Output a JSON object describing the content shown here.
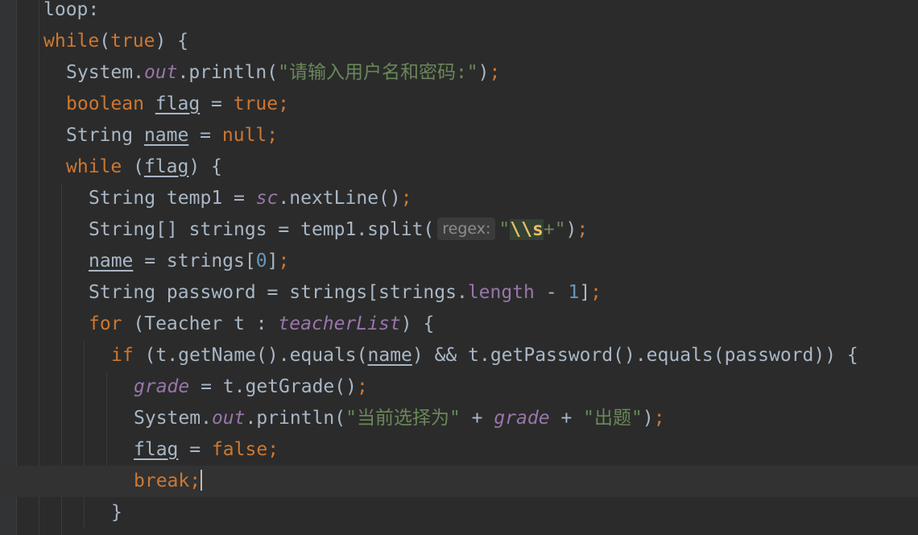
{
  "editor": {
    "theme_colors": {
      "background": "#2b2b2b",
      "keyword": "#cc7832",
      "string": "#6a8759",
      "field": "#9876aa",
      "number": "#6897bb",
      "text": "#a9b7c6"
    },
    "lines": {
      "l1": {
        "label": "loop:"
      },
      "l2": {
        "kw_while": "while",
        "p1": "(",
        "kw_true": "true",
        "p2": ") {"
      },
      "l3": {
        "sys": "System.",
        "out": "out",
        "println": ".println(",
        "str": "\"请输入用户名和密码:\"",
        "close": ")",
        "semi": ";"
      },
      "l4": {
        "kw_boolean": "boolean",
        "sp": " ",
        "flag": "flag",
        "eq": " = ",
        "kw_true": "true",
        "semi": ";"
      },
      "l5": {
        "type": "String ",
        "name": "name",
        "eq": " = ",
        "kw_null": "null",
        "semi": ";"
      },
      "l6": {
        "kw_while": "while",
        "p1": " (",
        "flag": "flag",
        "p2": ") {"
      },
      "l7": {
        "a": "String temp1 = ",
        "sc": "sc",
        "b": ".nextLine()",
        "semi": ";"
      },
      "l8": {
        "a": "String[] strings = temp1.split(",
        "hint": "regex:",
        "q1": "\"",
        "esc": "\\\\s",
        "plus": "+",
        "q2": "\"",
        "close": ")",
        "semi": ";"
      },
      "l9": {
        "name": "name",
        "a": " = strings[",
        "zero": "0",
        "b": "]",
        "semi": ";"
      },
      "l10": {
        "a": "String password = strings[strings.",
        "length": "length",
        "b": " - ",
        "one": "1",
        "c": "]",
        "semi": ";"
      },
      "l11": {
        "kw_for": "for",
        "a": " (Teacher t : ",
        "list": "teacherList",
        "b": ") {"
      },
      "l12": {
        "kw_if": "if",
        "a": " (t.getName().equals(",
        "name": "name",
        "b": ") && t.getPassword().equals(password)) {"
      },
      "l13": {
        "grade": "grade",
        "a": " = t.getGrade()",
        "semi": ";"
      },
      "l14": {
        "sys": "System.",
        "out": "out",
        "println": ".println(",
        "str1": "\"当前选择为\"",
        "plus1": " + ",
        "grade": "grade",
        "plus2": " + ",
        "str2": "\"出题\"",
        "close": ")",
        "semi": ";"
      },
      "l15": {
        "flag": "flag",
        "eq": " = ",
        "kw_false": "false",
        "semi": ";"
      },
      "l16": {
        "kw_break": "break",
        "semi": ";"
      },
      "l17": {
        "brace": "}"
      }
    }
  }
}
